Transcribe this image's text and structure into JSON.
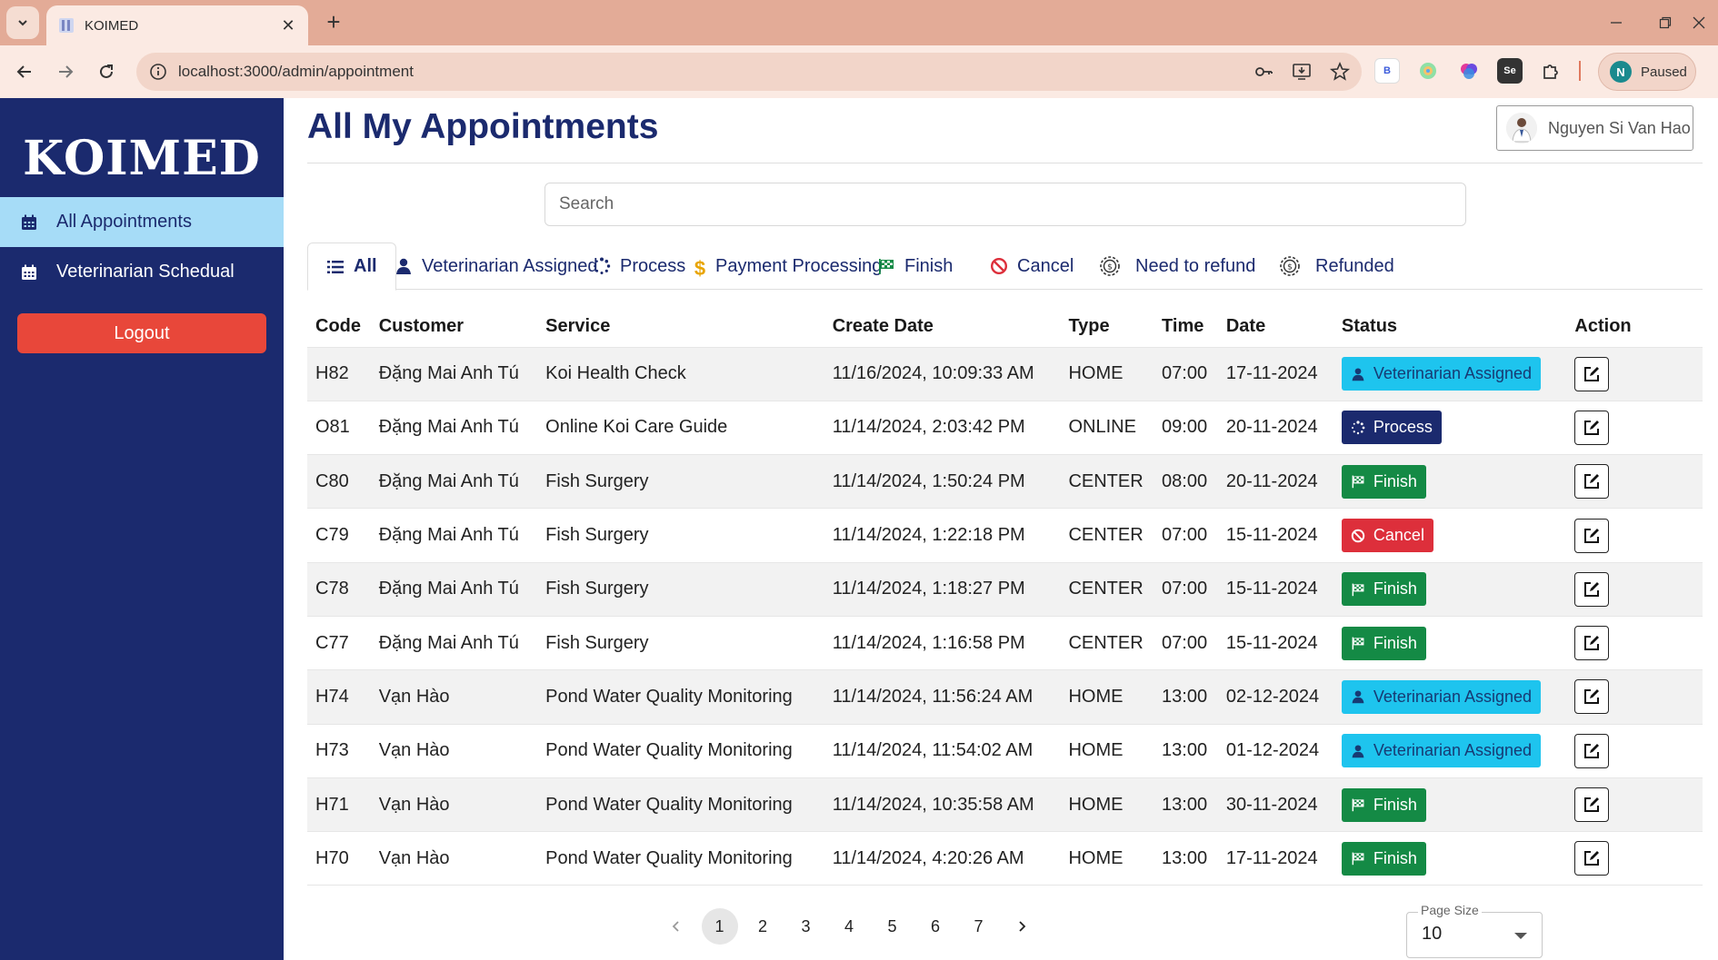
{
  "browser": {
    "tab_title": "KOIMED",
    "url": "localhost:3000/admin/appointment",
    "profile_initial": "N",
    "profile_status": "Paused",
    "extensions": [
      {
        "name": "bing-extension-icon",
        "label": "B",
        "bg": "#ffffff",
        "fg": "#3b5bdb"
      },
      {
        "name": "colorful-extension-icon",
        "label": "",
        "bg": "#fbeae3",
        "fg": "#2a2"
      },
      {
        "name": "brain-extension-icon",
        "label": "",
        "bg": "#fbeae3",
        "fg": "#a3d"
      },
      {
        "name": "selenium-extension-icon",
        "label": "Se",
        "bg": "#333333",
        "fg": "#ffffff"
      }
    ]
  },
  "sidebar": {
    "brand": "KOIMED",
    "items": [
      {
        "label": "All Appointments",
        "active": true
      },
      {
        "label": "Veterinarian Schedual",
        "active": false
      }
    ],
    "logout_label": "Logout"
  },
  "header": {
    "title": "All My Appointments",
    "user_name": "Nguyen Si Van Hao"
  },
  "search": {
    "placeholder": "Search"
  },
  "filter_tabs": [
    {
      "label": "All",
      "icon": "list-icon",
      "active": true
    },
    {
      "label": "Veterinarian Assigned",
      "icon": "user-icon"
    },
    {
      "label": "Process",
      "icon": "spinner-icon"
    },
    {
      "label": "Payment Processing",
      "icon": "dollar-icon"
    },
    {
      "label": "Finish",
      "icon": "flag-checkered-icon"
    },
    {
      "label": "Cancel",
      "icon": "ban-icon"
    },
    {
      "label": "Need to refund",
      "icon": "refund-coin-icon"
    },
    {
      "label": "Refunded",
      "icon": "refund-coin-icon"
    }
  ],
  "table": {
    "columns": [
      "Code",
      "Customer",
      "Service",
      "Create Date",
      "Type",
      "Time",
      "Date",
      "Status",
      "Action"
    ],
    "rows": [
      {
        "code": "H82",
        "customer": "Đặng Mai Anh Tú",
        "service": "Koi Health Check",
        "create_date": "11/16/2024, 10:09:33 AM",
        "type": "HOME",
        "time": "07:00",
        "date": "17-11-2024",
        "status": "Veterinarian Assigned",
        "status_kind": "assigned"
      },
      {
        "code": "O81",
        "customer": "Đặng Mai Anh Tú",
        "service": "Online Koi Care Guide",
        "create_date": "11/14/2024, 2:03:42 PM",
        "type": "ONLINE",
        "time": "09:00",
        "date": "20-11-2024",
        "status": "Process",
        "status_kind": "process"
      },
      {
        "code": "C80",
        "customer": "Đặng Mai Anh Tú",
        "service": "Fish Surgery",
        "create_date": "11/14/2024, 1:50:24 PM",
        "type": "CENTER",
        "time": "08:00",
        "date": "20-11-2024",
        "status": "Finish",
        "status_kind": "finish"
      },
      {
        "code": "C79",
        "customer": "Đặng Mai Anh Tú",
        "service": "Fish Surgery",
        "create_date": "11/14/2024, 1:22:18 PM",
        "type": "CENTER",
        "time": "07:00",
        "date": "15-11-2024",
        "status": "Cancel",
        "status_kind": "cancel"
      },
      {
        "code": "C78",
        "customer": "Đặng Mai Anh Tú",
        "service": "Fish Surgery",
        "create_date": "11/14/2024, 1:18:27 PM",
        "type": "CENTER",
        "time": "07:00",
        "date": "15-11-2024",
        "status": "Finish",
        "status_kind": "finish"
      },
      {
        "code": "C77",
        "customer": "Đặng Mai Anh Tú",
        "service": "Fish Surgery",
        "create_date": "11/14/2024, 1:16:58 PM",
        "type": "CENTER",
        "time": "07:00",
        "date": "15-11-2024",
        "status": "Finish",
        "status_kind": "finish"
      },
      {
        "code": "H74",
        "customer": "Vạn Hào",
        "service": "Pond Water Quality Monitoring",
        "create_date": "11/14/2024, 11:56:24 AM",
        "type": "HOME",
        "time": "13:00",
        "date": "02-12-2024",
        "status": "Veterinarian Assigned",
        "status_kind": "assigned"
      },
      {
        "code": "H73",
        "customer": "Vạn Hào",
        "service": "Pond Water Quality Monitoring",
        "create_date": "11/14/2024, 11:54:02 AM",
        "type": "HOME",
        "time": "13:00",
        "date": "01-12-2024",
        "status": "Veterinarian Assigned",
        "status_kind": "assigned"
      },
      {
        "code": "H71",
        "customer": "Vạn Hào",
        "service": "Pond Water Quality Monitoring",
        "create_date": "11/14/2024, 10:35:58 AM",
        "type": "HOME",
        "time": "13:00",
        "date": "30-11-2024",
        "status": "Finish",
        "status_kind": "finish"
      },
      {
        "code": "H70",
        "customer": "Vạn Hào",
        "service": "Pond Water Quality Monitoring",
        "create_date": "11/14/2024, 4:20:26 AM",
        "type": "HOME",
        "time": "13:00",
        "date": "17-11-2024",
        "status": "Finish",
        "status_kind": "finish"
      }
    ]
  },
  "pagination": {
    "pages": [
      "1",
      "2",
      "3",
      "4",
      "5",
      "6",
      "7"
    ],
    "current": "1",
    "page_size_label": "Page Size",
    "page_size": "10"
  },
  "colors": {
    "brand_navy": "#1b2a6e",
    "sidebar_active": "#a6dcf7",
    "logout_red": "#e8473a",
    "status_assigned": "#1ec4ee",
    "status_process": "#1b2a6e",
    "status_finish": "#148a45",
    "status_cancel": "#dd2f3b"
  }
}
